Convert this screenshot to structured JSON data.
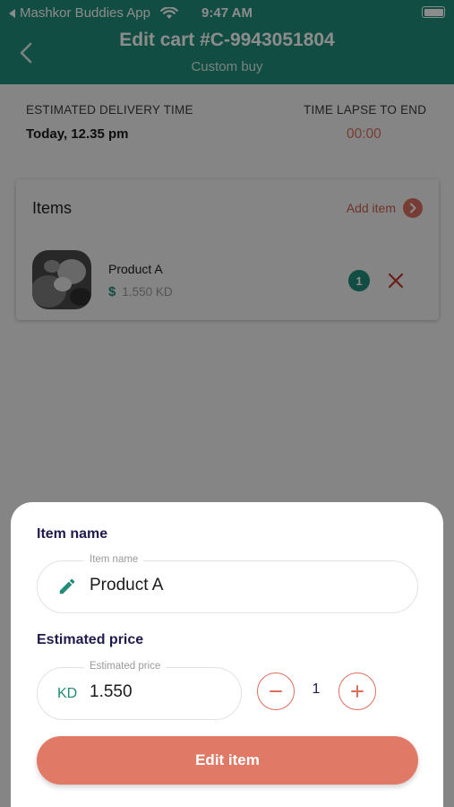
{
  "status_bar": {
    "carrier": "Mashkor Buddies App",
    "time": "9:47 AM"
  },
  "nav": {
    "title": "Edit cart #C-9943051804",
    "subtitle": "Custom buy"
  },
  "delivery": {
    "estimated_label": "ESTIMATED DELIVERY TIME",
    "estimated_value": "Today, 12.35 pm",
    "timelapse_label": "TIME LAPSE TO END",
    "timelapse_value": "00:00"
  },
  "items": {
    "title": "Items",
    "add_label": "Add item",
    "list": [
      {
        "name": "Product A",
        "price": "1.550 KD",
        "quantity": "1"
      }
    ]
  },
  "sheet": {
    "name_label": "Item name",
    "name_legend": "Item name",
    "name_value": "Product A",
    "price_label": "Estimated price",
    "price_legend": "Estimated price",
    "currency": "KD",
    "price_value": "1.550",
    "quantity": "1",
    "submit_label": "Edit item"
  },
  "colors": {
    "header": "#208c78",
    "accent": "#e07a66",
    "timer": "#d9705f"
  },
  "icons": {
    "back": "chevron-left-icon",
    "add": "chevron-right-icon",
    "remove": "close-icon",
    "edit": "pencil-icon",
    "decrease": "minus-icon",
    "increase": "plus-icon"
  }
}
